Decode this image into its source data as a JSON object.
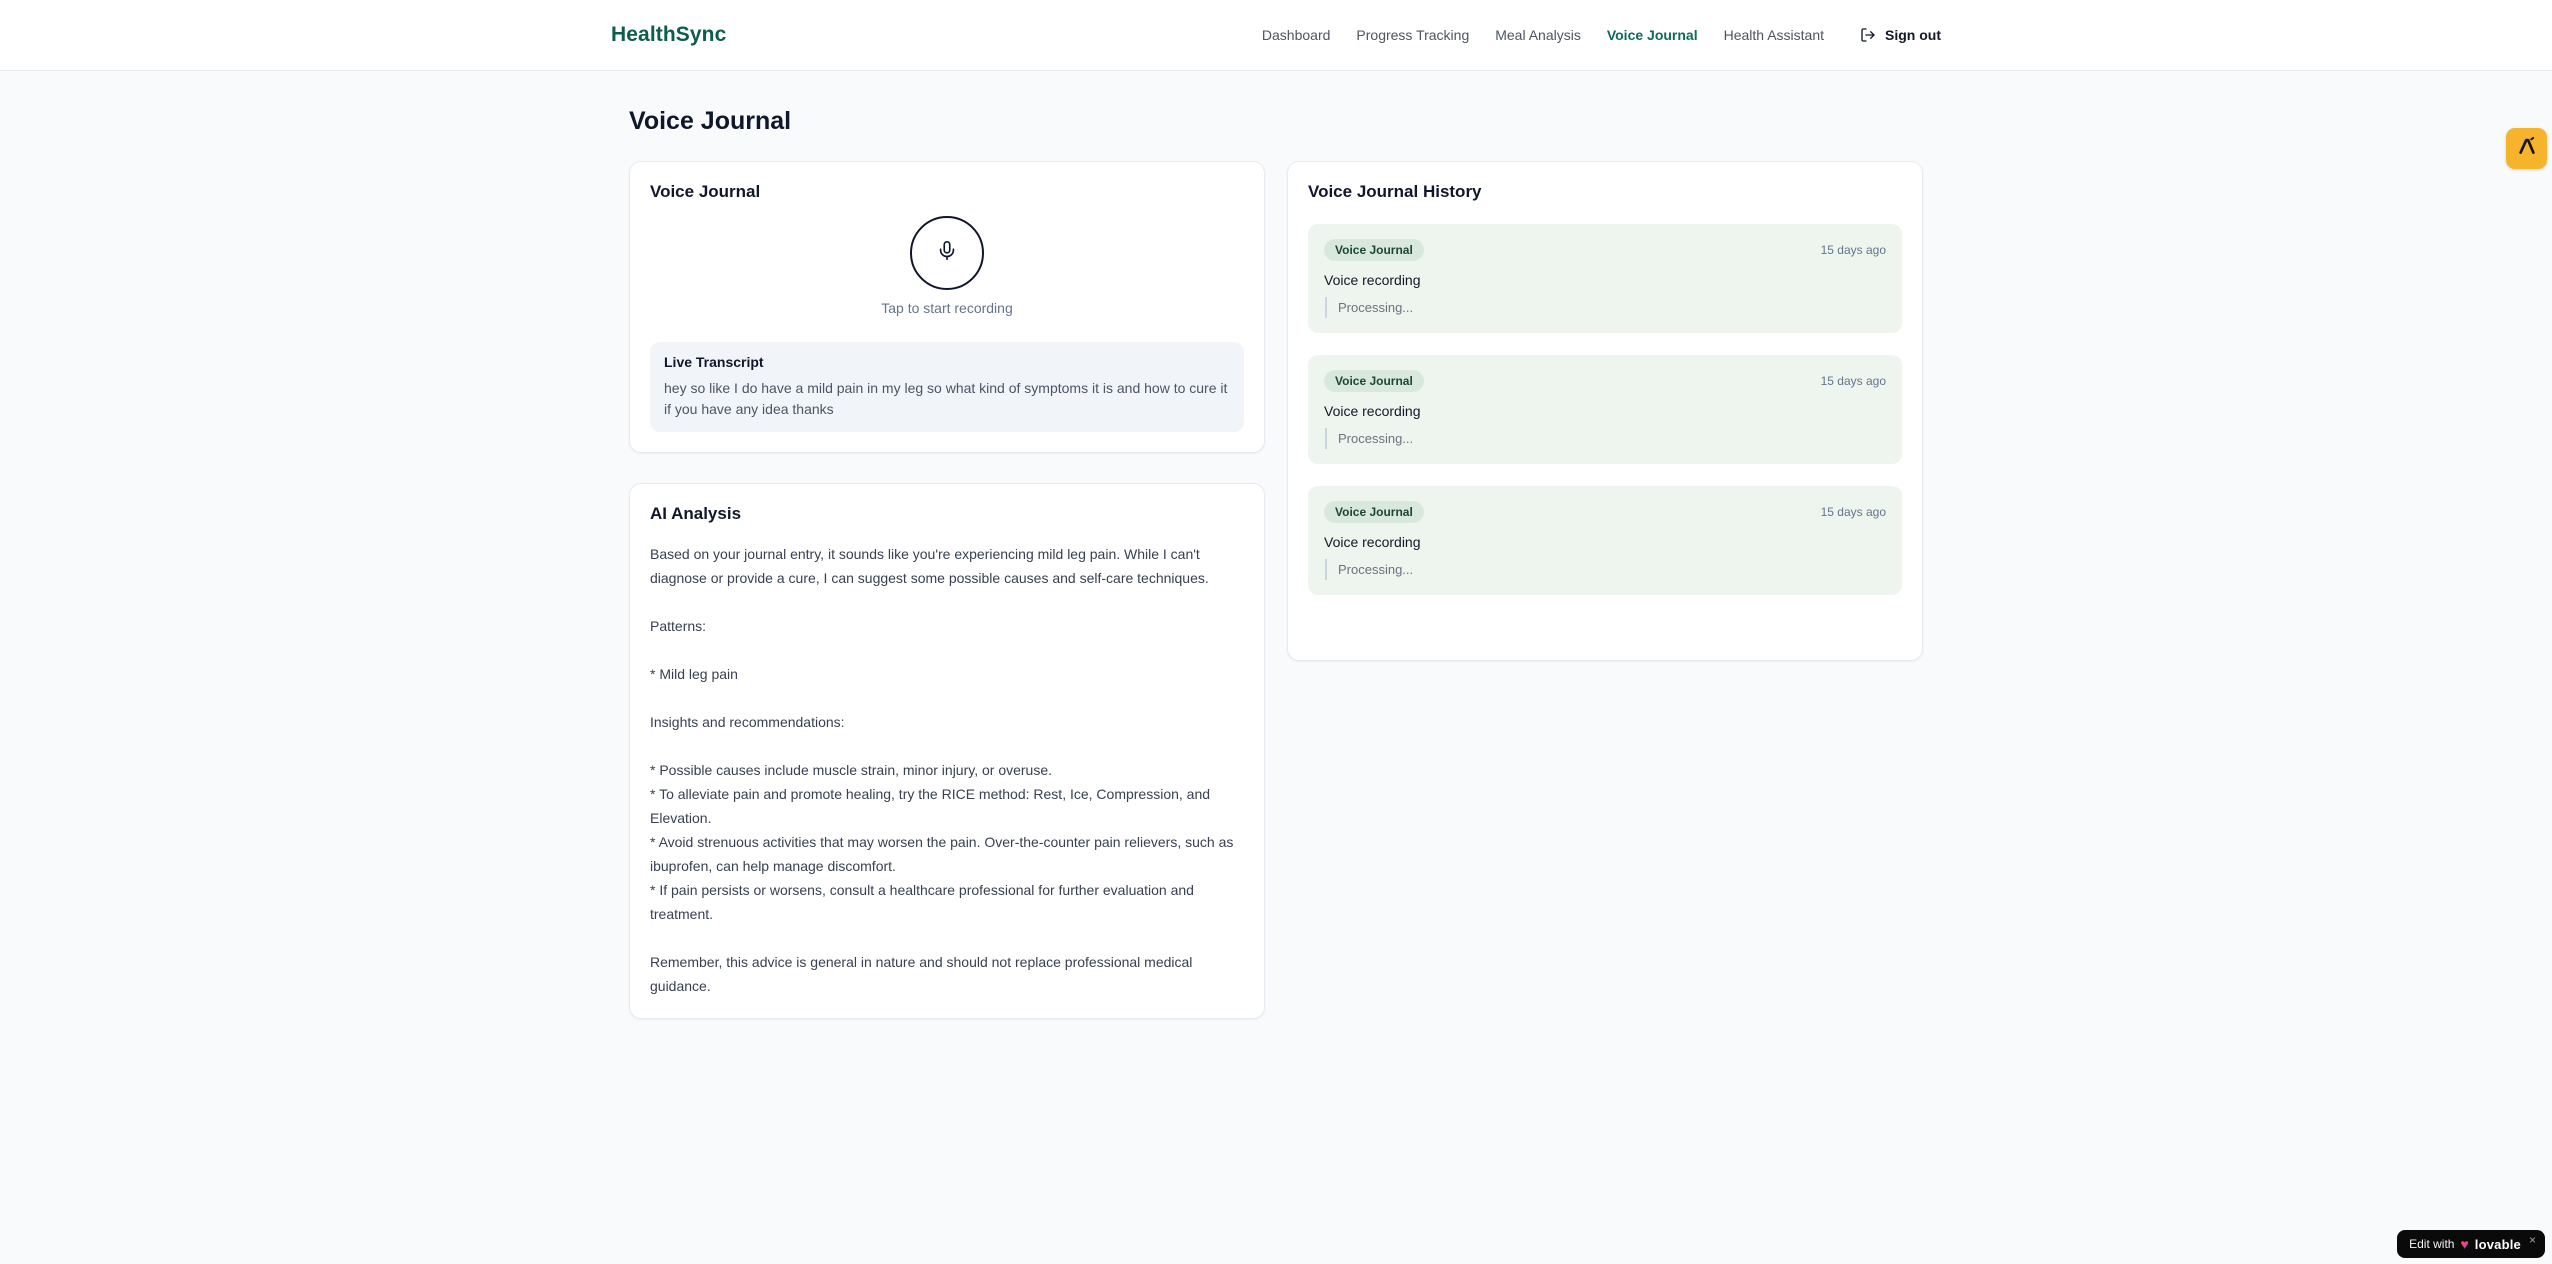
{
  "header": {
    "logo": "HealthSync",
    "nav": [
      {
        "label": "Dashboard"
      },
      {
        "label": "Progress Tracking"
      },
      {
        "label": "Meal Analysis"
      },
      {
        "label": "Voice Journal"
      },
      {
        "label": "Health Assistant"
      }
    ],
    "sign_out_label": "Sign out"
  },
  "page_title": "Voice Journal",
  "recorder": {
    "card_title": "Voice Journal",
    "tap_hint": "Tap to start recording",
    "transcript_title": "Live Transcript",
    "transcript_text": "hey so like I do have a mild pain in my leg so what kind of symptoms it is and how to cure it if you have any idea thanks"
  },
  "analysis": {
    "card_title": "AI Analysis",
    "paragraphs": [
      "Based on your journal entry, it sounds like you're experiencing mild leg pain. While I can't diagnose or provide a cure, I can suggest some possible causes and self-care techniques.",
      "Patterns:",
      "* Mild leg pain",
      "Insights and recommendations:",
      "* Possible causes include muscle strain, minor injury, or overuse.",
      "* To alleviate pain and promote healing, try the RICE method: Rest, Ice, Compression, and Elevation.",
      "* Avoid strenuous activities that may worsen the pain. Over-the-counter pain relievers, such as ibuprofen, can help manage discomfort.",
      "* If pain persists or worsens, consult a healthcare professional for further evaluation and treatment.",
      "Remember, this advice is general in nature and should not replace professional medical guidance."
    ]
  },
  "history": {
    "card_title": "Voice Journal History",
    "entries": [
      {
        "badge": "Voice Journal",
        "time": "15 days ago",
        "label": "Voice recording",
        "status": "Processing..."
      },
      {
        "badge": "Voice Journal",
        "time": "15 days ago",
        "label": "Voice recording",
        "status": "Processing..."
      },
      {
        "badge": "Voice Journal",
        "time": "15 days ago",
        "label": "Voice recording",
        "status": "Processing..."
      }
    ]
  },
  "floating": {
    "edit_prefix": "Edit with",
    "edit_brand": "lovable",
    "close": "×"
  },
  "colors": {
    "brand_teal": "#0d5c4e",
    "nav_active_teal": "#0e6a5c",
    "amber_side_button": "#f6b42c",
    "history_entry_bg": "#eef5ef",
    "badge_bg": "#d9e8dc",
    "badge_text": "#1b4638",
    "page_bg": "#f8fafc"
  }
}
